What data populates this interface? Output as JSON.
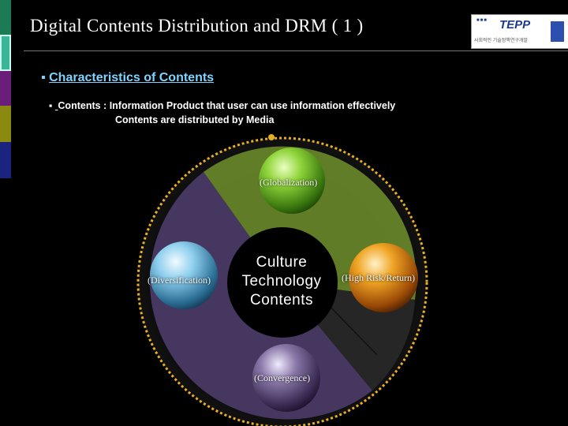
{
  "slide": {
    "title": "Digital Contents Distribution and DRM ( 1 )",
    "accent_colors": [
      "#2aa47a",
      "#7a1f8a",
      "#8a8a10",
      "#1a2a8a"
    ]
  },
  "logo": {
    "word": "TEPP",
    "subtitle": "사회적인 기술정책연구개발",
    "dots": "■■■"
  },
  "section": {
    "bullet": "▪",
    "heading": "Characteristics of  Contents"
  },
  "definition": {
    "bullet": "▪",
    "term": "Contents",
    "separator": " :  ",
    "line1": "Information Product that user can use information effectively",
    "line2": "Contents are distributed by Media"
  },
  "diagram": {
    "center": [
      "Culture",
      "Technology",
      "Contents"
    ],
    "nodes": {
      "top": "(Globalization)",
      "left": "(Diversification)",
      "right": "(High Risk/Return)",
      "bottom": "(Convergence)"
    },
    "colors": {
      "ring_border": "#e8b020",
      "green_segment": "#6a8a2a",
      "purple_segment": "#4a3a66",
      "top_sphere": "#6cbf2e",
      "left_sphere": "#6ab4d8",
      "right_sphere": "#e08a12",
      "bottom_sphere": "#5a4a70"
    }
  }
}
